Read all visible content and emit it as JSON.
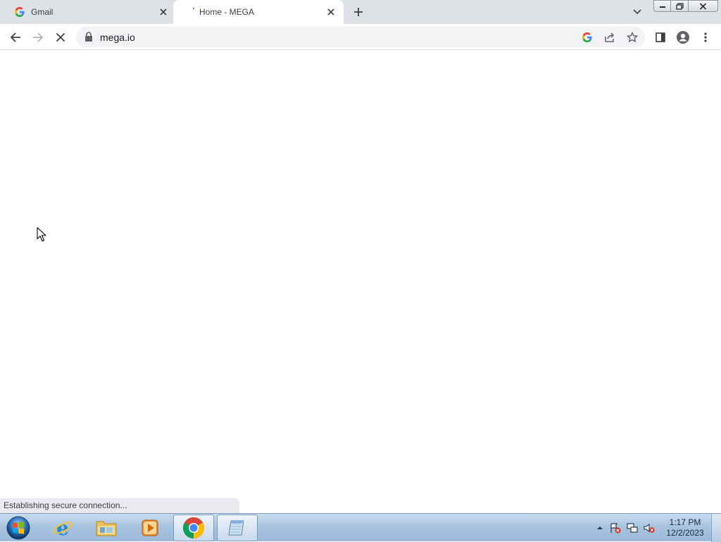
{
  "browser": {
    "tabs": [
      {
        "title": "Gmail",
        "favicon": "google-g-icon",
        "active": false
      },
      {
        "title": "Home - MEGA",
        "favicon": "mega-loading-icon",
        "active": true
      }
    ],
    "url": "mega.io",
    "status_text": "Establishing secure connection..."
  },
  "taskbar": {
    "apps": [
      {
        "name": "Internet Explorer",
        "icon": "internet-explorer-icon"
      },
      {
        "name": "Windows Explorer",
        "icon": "folder-icon"
      },
      {
        "name": "Windows Media Player",
        "icon": "media-player-icon"
      },
      {
        "name": "Google Chrome",
        "icon": "chrome-icon"
      },
      {
        "name": "Notepad",
        "icon": "notepad-icon"
      }
    ],
    "clock": {
      "time": "1:17 PM",
      "date": "12/2/2023"
    }
  },
  "colors": {
    "tabstrip_bg": "#dee1e6",
    "omnibox_bg": "#f1f3f4",
    "taskbar_bg": "#a9c4e0"
  }
}
